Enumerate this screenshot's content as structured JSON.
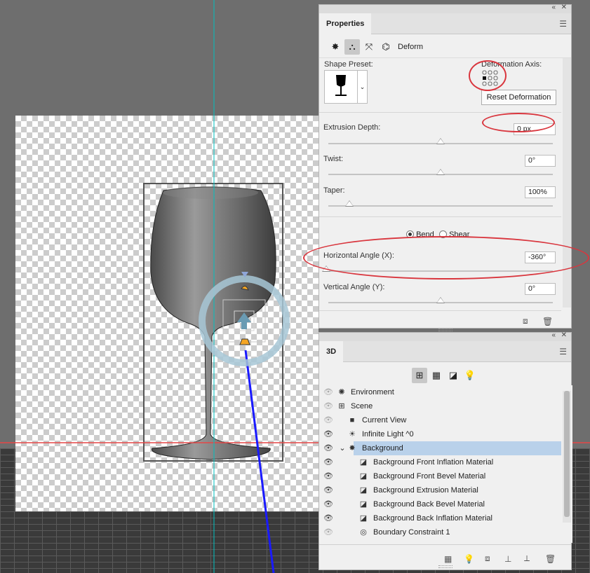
{
  "colors": {
    "guide": "#00c0c0",
    "axis_red": "#e64646",
    "axis_blue": "#1a1aff",
    "annotation_red": "#d9363e",
    "selected_row": "#b9d1ea"
  },
  "properties": {
    "tab_label": "Properties",
    "mode_icons": [
      "mesh-icon",
      "deform-icon",
      "cap-icon",
      "coordinates-icon"
    ],
    "mode_label": "Deform",
    "shape_preset_label": "Shape Preset:",
    "deformation_axis_label": "Deformation Axis:",
    "reset_button": "Reset Deformation",
    "extrusion_depth_label": "Extrusion Depth:",
    "extrusion_depth_value": "0 px",
    "twist_label": "Twist:",
    "twist_value": "0°",
    "taper_label": "Taper:",
    "taper_value": "100%",
    "bend_label": "Bend",
    "shear_label": "Shear",
    "bend_selected": true,
    "horizontal_angle_label": "Horizontal Angle (X):",
    "horizontal_angle_value": "-360°",
    "vertical_angle_label": "Vertical Angle (Y):",
    "vertical_angle_value": "0°"
  },
  "threed": {
    "tab_label": "3D",
    "filter_icons": [
      "scene-filter-icon",
      "mesh-filter-icon",
      "material-filter-icon",
      "light-filter-icon"
    ],
    "layers": [
      {
        "name": "Environment",
        "icon": "environment-icon",
        "visible": false
      },
      {
        "name": "Scene",
        "icon": "scene-icon",
        "visible": false
      },
      {
        "name": "Current View",
        "icon": "camera-icon",
        "visible": false
      },
      {
        "name": "Infinite Light ^0",
        "icon": "infinite-light-icon",
        "visible": true
      },
      {
        "name": "Background",
        "icon": "mesh-icon",
        "visible": true,
        "selected": true,
        "expanded": true
      },
      {
        "name": "Background Front Inflation Material",
        "icon": "material-icon",
        "visible": true
      },
      {
        "name": "Background Front Bevel Material",
        "icon": "material-icon",
        "visible": true
      },
      {
        "name": "Background Extrusion Material",
        "icon": "material-icon",
        "visible": true
      },
      {
        "name": "Background Back Bevel Material",
        "icon": "material-icon",
        "visible": true
      },
      {
        "name": "Background Back Inflation Material",
        "icon": "material-icon",
        "visible": true
      },
      {
        "name": "Boundary Constraint 1",
        "icon": "constraint-icon",
        "visible": false
      }
    ]
  }
}
